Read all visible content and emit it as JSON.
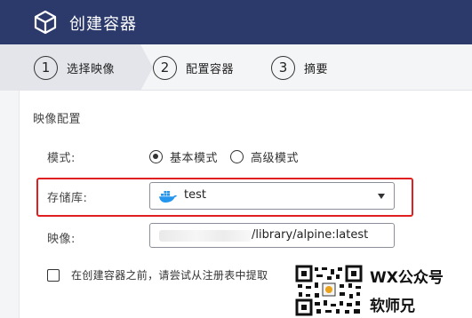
{
  "window": {
    "title": "创建容器",
    "icon": "cube-icon"
  },
  "steps": [
    {
      "number": "1",
      "label": "选择映像",
      "active": true
    },
    {
      "number": "2",
      "label": "配置容器",
      "active": false
    },
    {
      "number": "3",
      "label": "摘要",
      "active": false
    }
  ],
  "section": {
    "title": "映像配置"
  },
  "mode": {
    "label": "模式:",
    "options": [
      {
        "label": "基本模式",
        "checked": true
      },
      {
        "label": "高级模式",
        "checked": false
      }
    ]
  },
  "repository": {
    "label": "存储库:",
    "value": "test",
    "icon": "docker-icon"
  },
  "image": {
    "label": "映像:",
    "value": "/library/alpine:latest"
  },
  "pull_option": {
    "label": "在创建容器之前，请尝试从注册表中提取",
    "checked": false
  },
  "watermark": {
    "line1": "WX公众号",
    "line2": "软师兄"
  },
  "colors": {
    "title_bar": "#2b3a6b",
    "highlight": "#e02020",
    "docker_blue": "#2496ed"
  }
}
